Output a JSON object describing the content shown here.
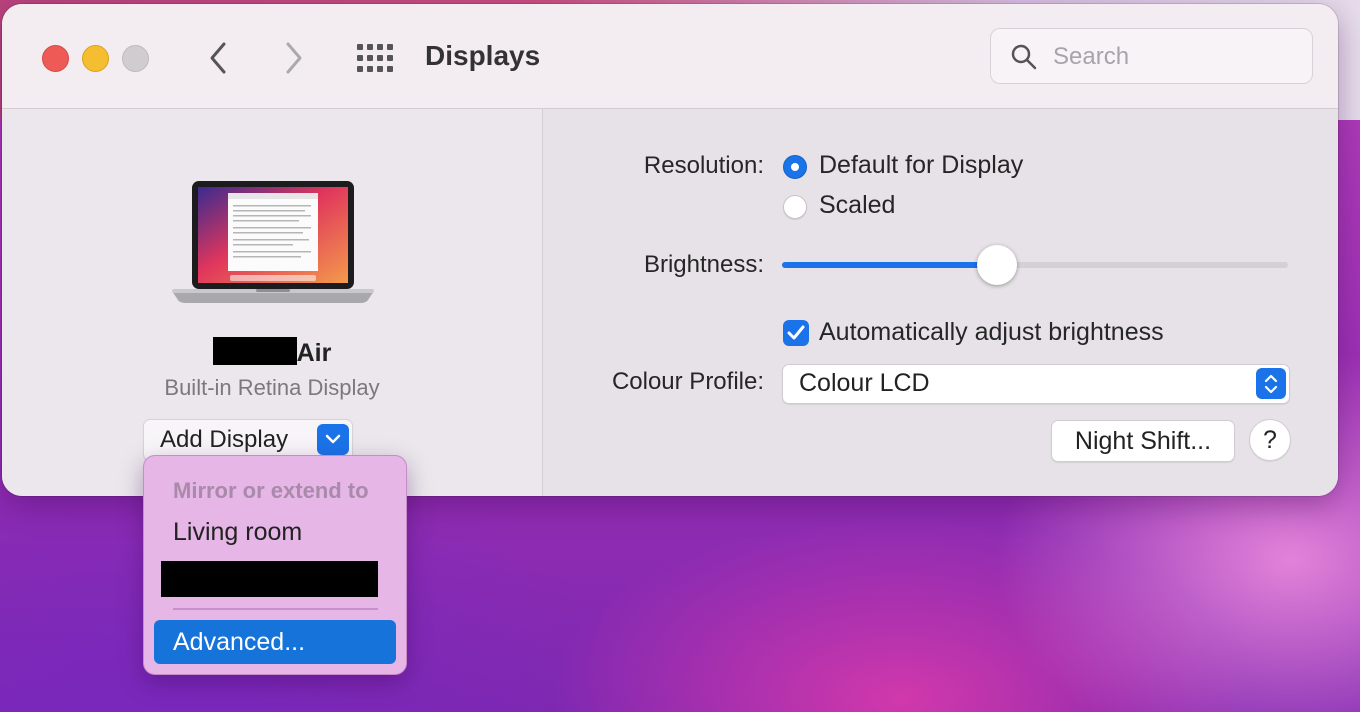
{
  "window": {
    "title": "Displays",
    "search_placeholder": "Search",
    "icons": {
      "back": "chevron-left-icon",
      "forward": "chevron-right-icon",
      "show_all": "grid-icon",
      "search": "magnifier-icon"
    }
  },
  "display": {
    "name_suffix": "Air",
    "subtitle": "Built-in Retina Display",
    "add_display_label": "Add Display"
  },
  "settings": {
    "resolution_label": "Resolution:",
    "resolution_options": [
      "Default for Display",
      "Scaled"
    ],
    "resolution_selected": "Default for Display",
    "brightness_label": "Brightness:",
    "brightness_level": 0.42,
    "auto_brightness_label": "Automatically adjust brightness",
    "auto_brightness_checked": true,
    "colour_profile_label": "Colour Profile:",
    "colour_profile_value": "Colour LCD",
    "night_shift_label": "Night Shift...",
    "help_label": "?"
  },
  "menu": {
    "header": "Mirror or extend to",
    "items": [
      "Living room"
    ],
    "advanced_label": "Advanced..."
  },
  "colors": {
    "accent": "#1a73e8",
    "menu_bg": "#e6b6e6",
    "close": "#ee5b56",
    "minimize": "#f5be31"
  }
}
